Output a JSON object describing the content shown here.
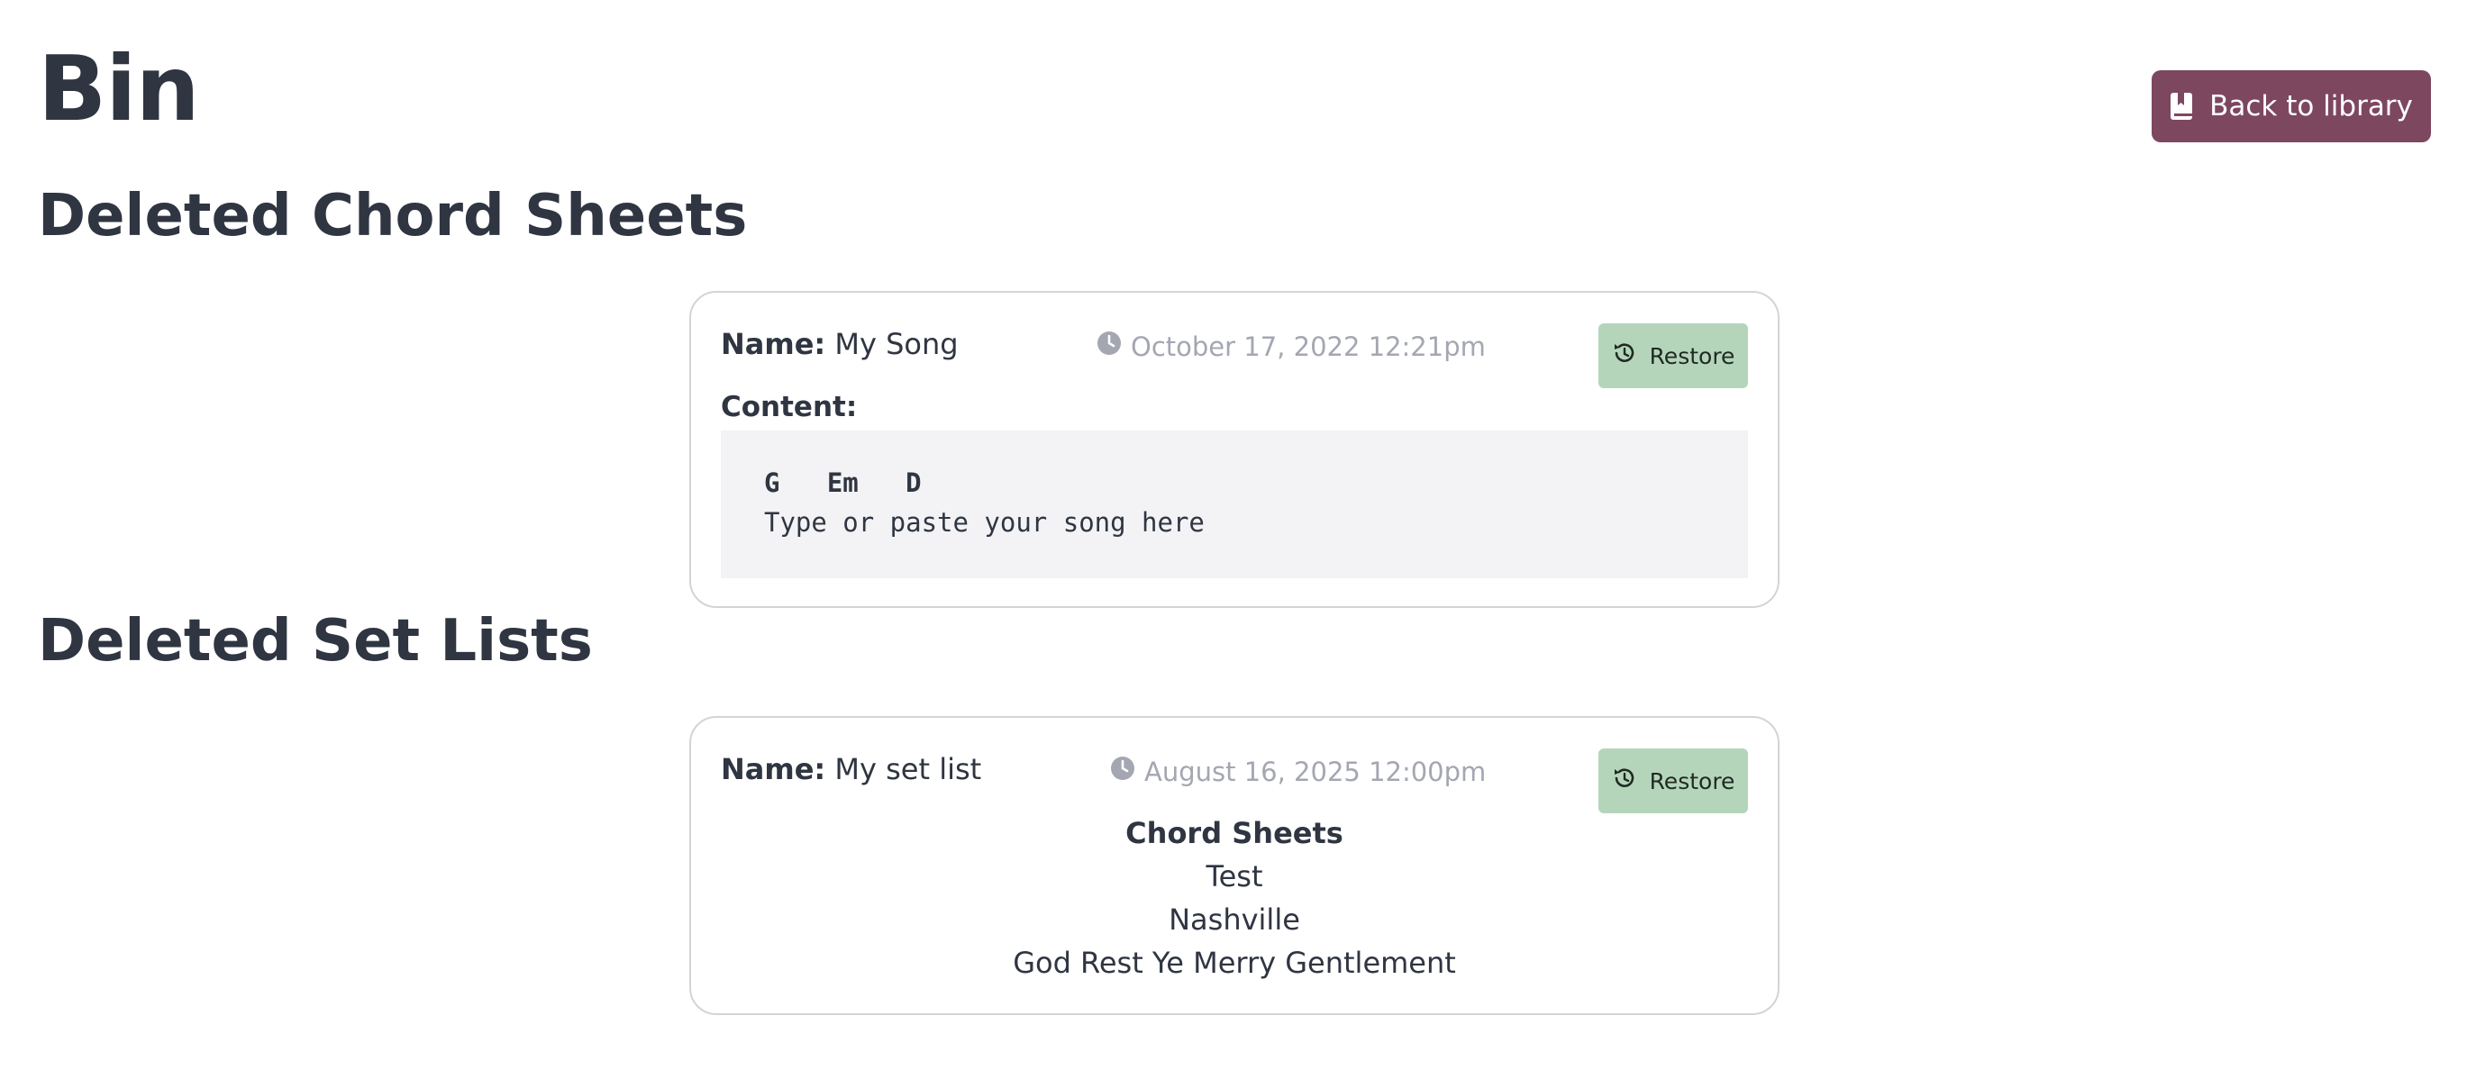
{
  "page": {
    "title": "Bin"
  },
  "header": {
    "back_button_label": "Back to library",
    "back_button_icon": "book-icon"
  },
  "deleted_chord_sheets": {
    "title": "Deleted Chord Sheets",
    "items": [
      {
        "name_label": "Name:",
        "name": "My Song",
        "date": "October 17, 2022 12:21pm",
        "restore_label": "Restore",
        "content_label": "Content:",
        "content_chords": "G   Em   D",
        "content_lyric": "Type or paste your song here"
      }
    ]
  },
  "deleted_set_lists": {
    "title": "Deleted Set Lists",
    "items": [
      {
        "name_label": "Name:",
        "name": "My set list",
        "date": "August 16, 2025 12:00pm",
        "restore_label": "Restore",
        "chord_sheets_heading": "Chord Sheets",
        "chord_sheets": [
          "Test",
          "Nashville",
          "God Rest Ye Merry Gentlement"
        ]
      }
    ]
  },
  "colors": {
    "brand": "#7d4760",
    "restore": "#b5d5bb",
    "muted_text": "#a4a7b1",
    "text": "#2f3541"
  }
}
